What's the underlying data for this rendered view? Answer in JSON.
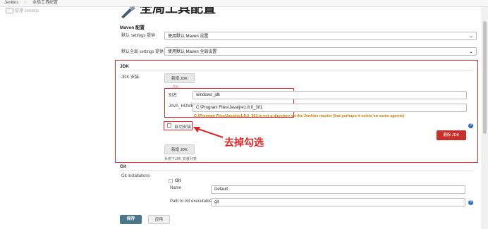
{
  "breadcrumb": {
    "root": "Jenkins",
    "sep": "›",
    "page": "全局工具配置"
  },
  "sidebar": {
    "label": "管理 Jenkins"
  },
  "page": {
    "title": "全局工具配置"
  },
  "maven": {
    "section_title": "Maven 配置",
    "settings_label": "默认 settings 提供",
    "settings_value": "使用默认 Maven 设置",
    "global_settings_label": "默认全局 settings 提供",
    "global_settings_value": "使用默认 Maven 全局设置"
  },
  "jdk": {
    "section_title": "JDK",
    "install_label": "JDK 安装",
    "add_button": "新增 JDK",
    "item_header": "JDK",
    "alias_label": "别名",
    "alias_value": "windows_jdk",
    "home_label": "JAVA_HOME",
    "home_value": "C:\\Program Files\\Java\\jre1.8.0_301",
    "warning": "C:\\Program Files\\Java\\jre1.8.0_301 is not a directory on the Jenkins master (but perhaps it exists on some agents)",
    "auto_install_label": "自动安装",
    "delete_button": "删除 JDK",
    "add_button_2": "新增 JDK",
    "list_note": "系统下JDK 安装列表"
  },
  "annotation": {
    "text": "去掉勾选",
    "color": "#e0262b"
  },
  "git": {
    "section_title": "Git",
    "installations_label": "Git installations",
    "item_header": "Git",
    "name_label": "Name",
    "name_value": "Default",
    "path_label": "Path to Git executable",
    "path_value": "git"
  },
  "footer": {
    "save_button": "保存",
    "apply_button": "应用"
  }
}
